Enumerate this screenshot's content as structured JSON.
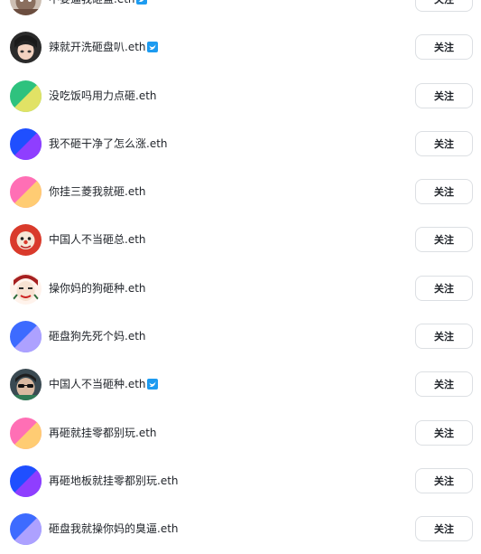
{
  "follow_label": "关注",
  "colors": {
    "verified_badge": "#1d9bf0",
    "button_border": "#dcdfe3",
    "text": "#1f2329"
  },
  "users": [
    {
      "name": "不要逼我砸盘.eth",
      "verified": true,
      "avatar": "photo-anime-cat"
    },
    {
      "name": "辣就开洗砸盘叭.eth",
      "verified": true,
      "avatar": "photo-anime-boy"
    },
    {
      "name": "没吃饭吗用力点砸.eth",
      "verified": false,
      "avatar": "gradient-green-yellow"
    },
    {
      "name": "我不砸干净了怎么涨.eth",
      "verified": false,
      "avatar": "gradient-blue-purple"
    },
    {
      "name": "你挂三菱我就砸.eth",
      "verified": false,
      "avatar": "gradient-pink-yellow"
    },
    {
      "name": "中国人不当砸总.eth",
      "verified": false,
      "avatar": "photo-clown"
    },
    {
      "name": "操你妈的狗砸种.eth",
      "verified": false,
      "avatar": "photo-clown-mask"
    },
    {
      "name": "砸盘狗先死个妈.eth",
      "verified": false,
      "avatar": "gradient-blue-lavender"
    },
    {
      "name": "中国人不当砸种.eth",
      "verified": true,
      "avatar": "photo-sunglasses"
    },
    {
      "name": "再砸就挂零都别玩.eth",
      "verified": false,
      "avatar": "gradient-pink-yellow"
    },
    {
      "name": "再砸地板就挂零都别玩.eth",
      "verified": false,
      "avatar": "gradient-blue-purple"
    },
    {
      "name": "砸盘我就操你妈的臭逼.eth",
      "verified": false,
      "avatar": "gradient-blue-lavender"
    }
  ]
}
